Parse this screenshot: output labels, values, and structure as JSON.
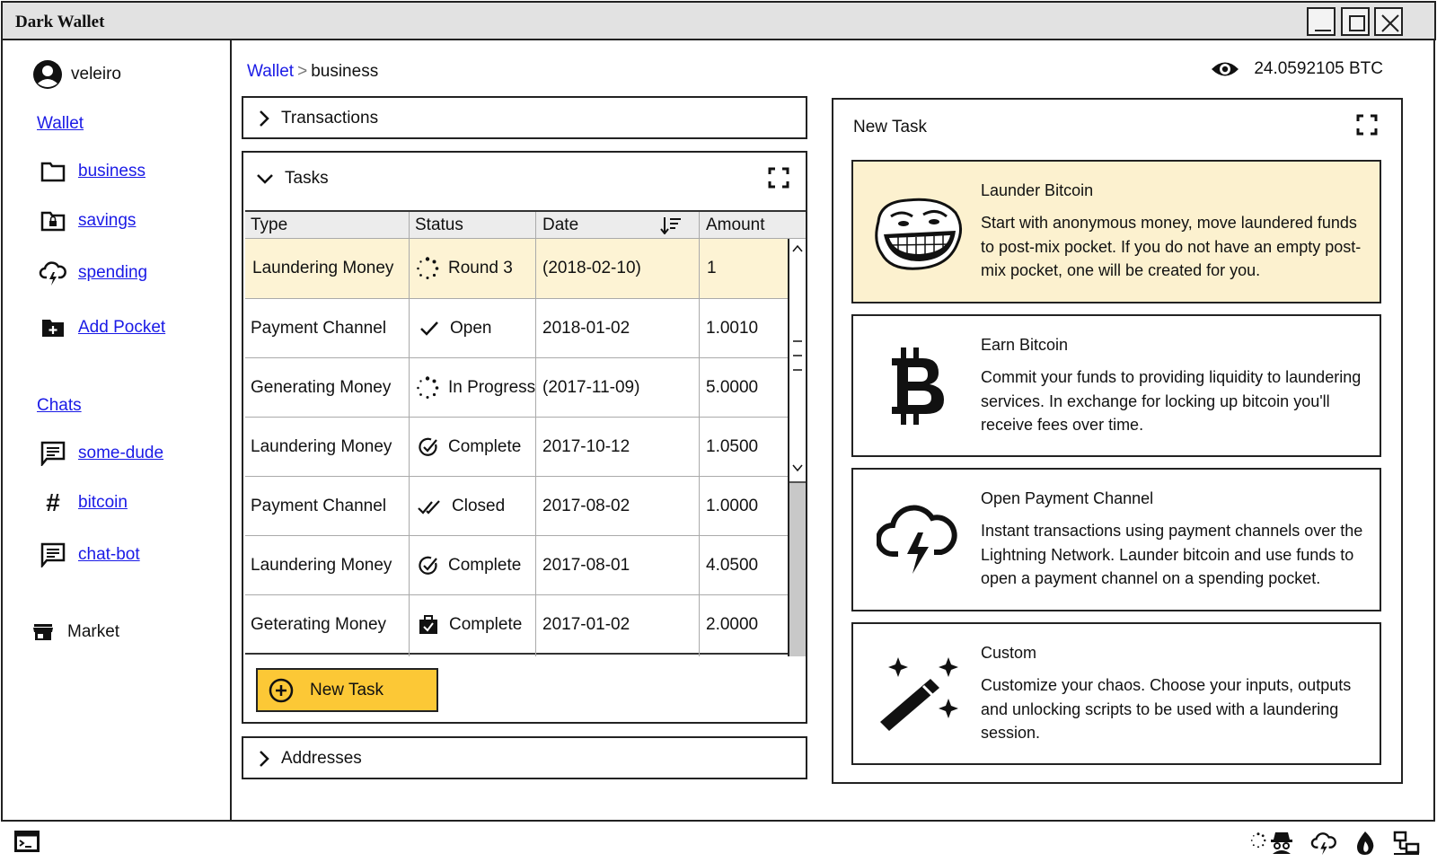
{
  "window": {
    "title": "Dark Wallet"
  },
  "sidebar": {
    "user": "veleiro",
    "wallet_label": "Wallet",
    "pockets": [
      {
        "label": "business",
        "icon": "folder-icon"
      },
      {
        "label": "savings",
        "icon": "lock-folder-icon"
      },
      {
        "label": "spending",
        "icon": "cloud-lightning-icon"
      },
      {
        "label": "Add Pocket",
        "icon": "add-folder-icon"
      }
    ],
    "chats_label": "Chats",
    "chats": [
      {
        "label": "some-dude",
        "icon": "chat-icon"
      },
      {
        "label": "bitcoin",
        "icon": "hashtag-icon"
      },
      {
        "label": "chat-bot",
        "icon": "chat-icon"
      }
    ],
    "market_label": "Market"
  },
  "header": {
    "breadcrumb_root": "Wallet",
    "breadcrumb_sep": ">",
    "breadcrumb_current": "business",
    "balance": "24.0592105 BTC"
  },
  "transactions_panel": {
    "title": "Transactions"
  },
  "tasks_panel": {
    "title": "Tasks",
    "columns": [
      "Type",
      "Status",
      "Date",
      "Amount"
    ],
    "rows": [
      {
        "type": "Laundering Money",
        "status": "Round 3",
        "status_icon": "spinner-icon",
        "date": "(2018-02-10)",
        "amount": "1"
      },
      {
        "type": "Payment Channel",
        "status": "Open",
        "status_icon": "check-icon",
        "date": "2018-01-02",
        "amount": "1.0010"
      },
      {
        "type": "Generating Money",
        "status": "In Progress",
        "status_icon": "spinner-icon",
        "date": "(2017-11-09)",
        "amount": "5.0000"
      },
      {
        "type": "Laundering Money",
        "status": "Complete",
        "status_icon": "check-circle-icon",
        "date": "2017-10-12",
        "amount": "1.0500"
      },
      {
        "type": "Payment Channel",
        "status": "Closed",
        "status_icon": "double-check-icon",
        "date": "2017-08-02",
        "amount": "1.0000"
      },
      {
        "type": "Laundering Money",
        "status": "Complete",
        "status_icon": "check-circle-icon",
        "date": "2017-08-01",
        "amount": "4.0500"
      },
      {
        "type": "Geterating Money",
        "status": "Complete",
        "status_icon": "check-briefcase-icon",
        "date": "2017-01-02",
        "amount": "2.0000"
      }
    ],
    "new_task_label": "New Task"
  },
  "addresses_panel": {
    "title": "Addresses"
  },
  "new_task_panel": {
    "title": "New Task",
    "cards": [
      {
        "title": "Launder Bitcoin",
        "desc": "Start with anonymous money, move laundered funds to post-mix pocket. If you do not have an empty post-mix pocket, one will be created for you.",
        "icon": "trollface-icon"
      },
      {
        "title": "Earn Bitcoin",
        "desc": "Commit your funds to providing liquidity to laundering services. In exchange for locking up bitcoin you'll receive fees over time.",
        "icon": "bitcoin-icon"
      },
      {
        "title": "Open Payment Channel",
        "desc": "Instant transactions using payment channels over the Lightning Network. Launder bitcoin and use funds to open a payment channel on a spending pocket.",
        "icon": "cloud-lightning-icon"
      },
      {
        "title": "Custom",
        "desc": "Customize your chaos. Choose your inputs, outputs and unlocking scripts to be used with a laundering session.",
        "icon": "magic-wand-icon"
      }
    ]
  },
  "statusbar": {
    "icons": [
      "terminal-icon",
      "spinner-icon",
      "spy-icon",
      "cloud-lightning-icon",
      "fire-drop-icon",
      "network-icon"
    ]
  }
}
